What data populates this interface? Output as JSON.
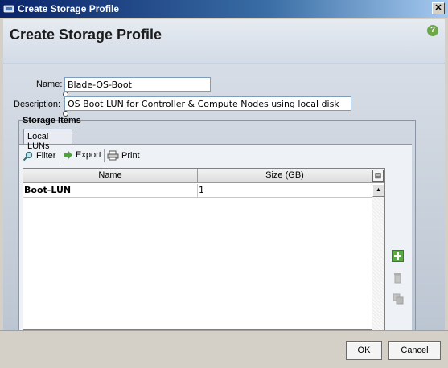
{
  "window": {
    "title": "Create Storage Profile",
    "close_glyph": "✕"
  },
  "header": {
    "title": "Create Storage Profile",
    "help_glyph": "?"
  },
  "form": {
    "name_label": "Name:",
    "name_value": "Blade-OS-Boot",
    "description_label": "Description:",
    "description_value": "OS Boot LUN for Controller & Compute Nodes using local disk"
  },
  "storage_items": {
    "group_title": "Storage Items",
    "tabs": [
      {
        "label": "Local LUNs"
      }
    ],
    "toolbar": {
      "filter_label": "Filter",
      "export_label": "Export",
      "print_label": "Print"
    },
    "columns": [
      "Name",
      "Size (GB)"
    ],
    "rows": [
      {
        "name": "Boot-LUN",
        "size": "1"
      }
    ]
  },
  "footer": {
    "ok_label": "OK",
    "cancel_label": "Cancel"
  },
  "colors": {
    "titlebar_dark": "#0a246a",
    "accent_green": "#6da74a"
  }
}
